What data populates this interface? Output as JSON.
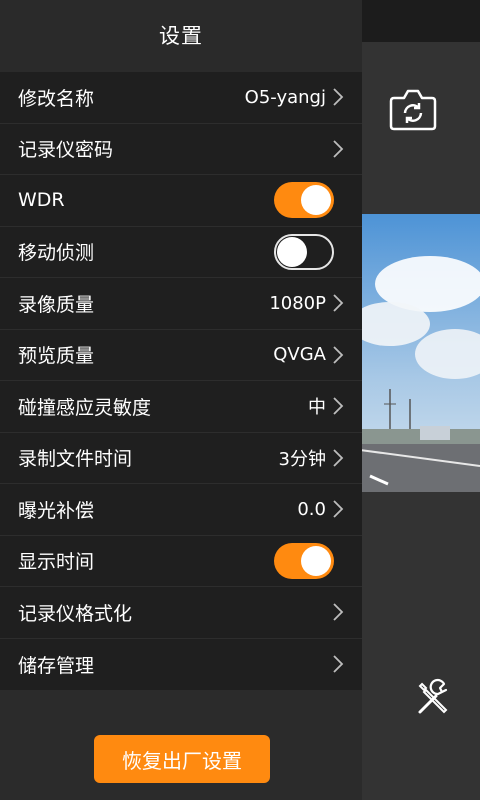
{
  "header": {
    "title": "设置"
  },
  "settings": [
    {
      "label": "修改名称",
      "value": "O5-yangj",
      "type": "link"
    },
    {
      "label": "记录仪密码",
      "value": "",
      "type": "link"
    },
    {
      "label": "WDR",
      "type": "toggle",
      "state": "on"
    },
    {
      "label": "移动侦测",
      "type": "toggle",
      "state": "off"
    },
    {
      "label": "录像质量",
      "value": "1080P",
      "type": "link"
    },
    {
      "label": "预览质量",
      "value": "QVGA",
      "type": "link"
    },
    {
      "label": "碰撞感应灵敏度",
      "value": "中",
      "type": "link"
    },
    {
      "label": "录制文件时间",
      "value": "3分钟",
      "type": "link"
    },
    {
      "label": "曝光补偿",
      "value": "0.0",
      "type": "link"
    },
    {
      "label": "显示时间",
      "type": "toggle",
      "state": "on"
    },
    {
      "label": "记录仪格式化",
      "value": "",
      "type": "link"
    },
    {
      "label": "储存管理",
      "value": "",
      "type": "link"
    }
  ],
  "footer": {
    "reset_label": "恢复出厂设置"
  },
  "colors": {
    "accent": "#ff8a10",
    "drawer_bg": "#2b2b2b",
    "row_bg": "#1f1f1f"
  },
  "icons": {
    "camera": "camera-switch-icon",
    "tools": "tools-icon",
    "chevron": "chevron-right-icon"
  }
}
